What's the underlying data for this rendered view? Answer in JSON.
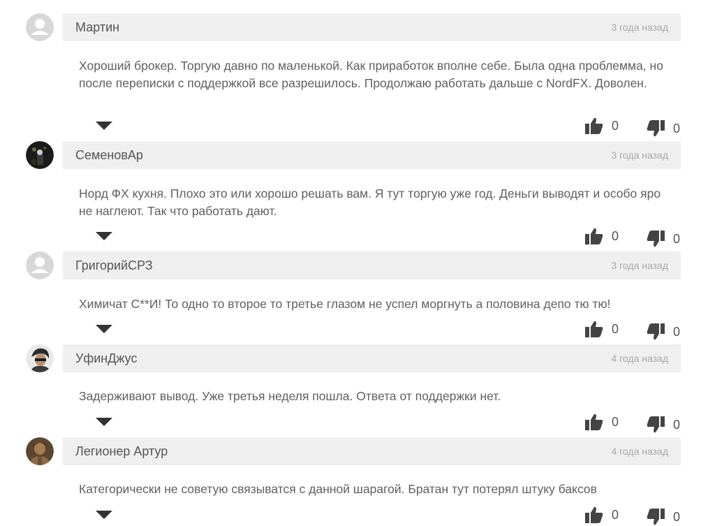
{
  "comments": [
    {
      "author": "Мартин",
      "time": "3 года назад",
      "text": "Хороший брокер. Торгую давно по маленькой. Как приработок вполне себе. Была одна проблемма, но после переписки с поддержкой все разрешилось. Продолжаю работать дальше с NordFX. Доволен.",
      "likes": "0",
      "dislikes": "0",
      "avatar": "default-avatar"
    },
    {
      "author": "СеменовАр",
      "time": "3 года назад",
      "text": "Норд ФХ кухня. Плохо это или хорошо решать вам. Я тут торгую уже год. Деньги выводят и особо яро не наглеют. Так что работать дают.",
      "likes": "0",
      "dislikes": "0",
      "avatar": "photo-avatar"
    },
    {
      "author": "ГригорийСРЗ",
      "time": "3 года назад",
      "text": "Химичат С**И! То одно то второе то третье глазом не успел моргнуть а половина депо тю тю!",
      "likes": "0",
      "dislikes": "0",
      "avatar": "default-avatar"
    },
    {
      "author": "УфинДжус",
      "time": "4 года назад",
      "text": "Задерживают вывод. Уже третья неделя пошла. Ответа от поддержки нет.",
      "likes": "0",
      "dislikes": "0",
      "avatar": "photo-avatar"
    },
    {
      "author": "Легионер Артур",
      "time": "4 года назад",
      "text": "Категорически не советую связыватся с данной шарагой. Братан тут потерял штуку баксов",
      "likes": "0",
      "dislikes": "0",
      "avatar": "photo-avatar"
    }
  ],
  "icons": {
    "like": "thumbs-up-icon",
    "dislike": "thumbs-down-icon",
    "expand": "triangle-down-icon"
  },
  "colors": {
    "header_bg": "#efefef",
    "author": "#555555",
    "time": "#a8a8a8",
    "text": "#606060",
    "default_avatar_bg": "#d8d8d8"
  }
}
